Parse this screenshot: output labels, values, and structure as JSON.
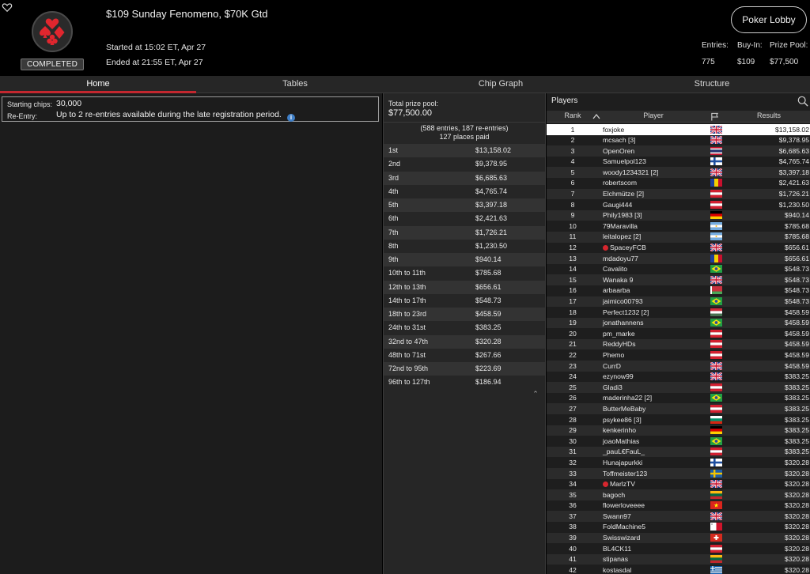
{
  "header": {
    "title": "$109 Sunday Fenomeno, $70K Gtd",
    "started": "Started at 15:02 ET, Apr 27",
    "ended": "Ended at 21:55 ET, Apr 27",
    "status": "COMPLETED",
    "lobby_button": "Poker Lobby",
    "stats": [
      {
        "label": "Entries:",
        "value": "775"
      },
      {
        "label": "Buy-In:",
        "value": "$109"
      },
      {
        "label": "Prize Pool:",
        "value": "$77,500"
      }
    ]
  },
  "tabs": [
    "Home",
    "Tables",
    "Chip Graph",
    "Structure"
  ],
  "active_tab": "Home",
  "info": {
    "starting_chips_label": "Starting chips:",
    "starting_chips_value": "30,000",
    "reentry_label": "Re-Entry:",
    "reentry_value": "Up to 2 re-entries available during the late registration period."
  },
  "prize": {
    "total_label": "Total prize pool:",
    "total_value": "$77,500.00",
    "entries_text": "(588 entries, 187 re-entries)",
    "places_text": "127 places paid",
    "rows": [
      {
        "place": "1st",
        "amount": "$13,158.02"
      },
      {
        "place": "2nd",
        "amount": "$9,378.95"
      },
      {
        "place": "3rd",
        "amount": "$6,685.63"
      },
      {
        "place": "4th",
        "amount": "$4,765.74"
      },
      {
        "place": "5th",
        "amount": "$3,397.18"
      },
      {
        "place": "6th",
        "amount": "$2,421.63"
      },
      {
        "place": "7th",
        "amount": "$1,726.21"
      },
      {
        "place": "8th",
        "amount": "$1,230.50"
      },
      {
        "place": "9th",
        "amount": "$940.14"
      },
      {
        "place": "10th to 11th",
        "amount": "$785.68"
      },
      {
        "place": "12th to 13th",
        "amount": "$656.61"
      },
      {
        "place": "14th to 17th",
        "amount": "$548.73"
      },
      {
        "place": "18th to 23rd",
        "amount": "$458.59"
      },
      {
        "place": "24th to 31st",
        "amount": "$383.25"
      },
      {
        "place": "32nd to 47th",
        "amount": "$320.28"
      },
      {
        "place": "48th to 71st",
        "amount": "$267.66"
      },
      {
        "place": "72nd to 95th",
        "amount": "$223.69"
      },
      {
        "place": "96th to 127th",
        "amount": "$186.94"
      }
    ]
  },
  "players": {
    "title": "Players",
    "columns": [
      "Rank",
      "Player",
      "Results"
    ],
    "rows": [
      {
        "rank": "1",
        "name": "foxjoke",
        "flag": "gb",
        "result": "$13,158.02",
        "selected": true
      },
      {
        "rank": "2",
        "name": "mcsach [3]",
        "flag": "gb",
        "result": "$9,378.95"
      },
      {
        "rank": "3",
        "name": "OpenOren",
        "flag": "th",
        "result": "$6,685.63"
      },
      {
        "rank": "4",
        "name": "Samuelpol123",
        "flag": "fi",
        "result": "$4,765.74"
      },
      {
        "rank": "5",
        "name": "woody1234321 [2]",
        "flag": "gb",
        "result": "$3,397.18"
      },
      {
        "rank": "6",
        "name": "robertscom",
        "flag": "ro",
        "result": "$2,421.63"
      },
      {
        "rank": "7",
        "name": "Elchmütze [2]",
        "flag": "at",
        "result": "$1,726.21"
      },
      {
        "rank": "8",
        "name": "Gaugi444",
        "flag": "at",
        "result": "$1,230.50"
      },
      {
        "rank": "9",
        "name": "Phily1983 [3]",
        "flag": "de",
        "result": "$940.14"
      },
      {
        "rank": "10",
        "name": "79Maravilla",
        "flag": "ar",
        "result": "$785.68"
      },
      {
        "rank": "11",
        "name": "leitalopez [2]",
        "flag": "ar",
        "result": "$785.68"
      },
      {
        "rank": "12",
        "name": "SpaceyFCB",
        "flag": "gb",
        "result": "$656.61",
        "badge": true
      },
      {
        "rank": "13",
        "name": "mdadoyu77",
        "flag": "ro",
        "result": "$656.61"
      },
      {
        "rank": "14",
        "name": "Cavalito",
        "flag": "br",
        "result": "$548.73"
      },
      {
        "rank": "15",
        "name": "Wanaka 9",
        "flag": "gb",
        "result": "$548.73"
      },
      {
        "rank": "16",
        "name": "arbaarba",
        "flag": "by",
        "result": "$548.73"
      },
      {
        "rank": "17",
        "name": "jaimico00793",
        "flag": "br",
        "result": "$548.73"
      },
      {
        "rank": "18",
        "name": "Perfect1232 [2]",
        "flag": "hu",
        "result": "$458.59"
      },
      {
        "rank": "19",
        "name": "jonathannens",
        "flag": "br",
        "result": "$458.59"
      },
      {
        "rank": "20",
        "name": "pm_marke",
        "flag": "at",
        "result": "$458.59"
      },
      {
        "rank": "21",
        "name": "ReddyHDs",
        "flag": "at",
        "result": "$458.59"
      },
      {
        "rank": "22",
        "name": "Phemo",
        "flag": "at",
        "result": "$458.59"
      },
      {
        "rank": "23",
        "name": "CurrD",
        "flag": "gb",
        "result": "$458.59"
      },
      {
        "rank": "24",
        "name": "ezynow99",
        "flag": "gb",
        "result": "$383.25"
      },
      {
        "rank": "25",
        "name": "Gladi3",
        "flag": "at",
        "result": "$383.25"
      },
      {
        "rank": "26",
        "name": "maderinha22 [2]",
        "flag": "br",
        "result": "$383.25"
      },
      {
        "rank": "27",
        "name": "ButterMeBaby",
        "flag": "at",
        "result": "$383.25"
      },
      {
        "rank": "28",
        "name": "psykee86 [3]",
        "flag": "bg",
        "result": "$383.25"
      },
      {
        "rank": "29",
        "name": "kenkerinho",
        "flag": "de",
        "result": "$383.25"
      },
      {
        "rank": "30",
        "name": "joaoMathias",
        "flag": "br",
        "result": "$383.25"
      },
      {
        "rank": "31",
        "name": "_pauL€FauL_",
        "flag": "at",
        "result": "$383.25"
      },
      {
        "rank": "32",
        "name": "Hunajapurkki",
        "flag": "fi",
        "result": "$320.28"
      },
      {
        "rank": "33",
        "name": "Toffmeister123",
        "flag": "se",
        "result": "$320.28"
      },
      {
        "rank": "34",
        "name": "MarlzTV",
        "flag": "gb",
        "result": "$320.28",
        "badge": true
      },
      {
        "rank": "35",
        "name": "bagoch",
        "flag": "lt",
        "result": "$320.28"
      },
      {
        "rank": "36",
        "name": "flowerloveeee",
        "flag": "vn",
        "result": "$320.28"
      },
      {
        "rank": "37",
        "name": "Swann97",
        "flag": "gb",
        "result": "$320.28"
      },
      {
        "rank": "38",
        "name": "FoldMachine5",
        "flag": "mt",
        "result": "$320.28"
      },
      {
        "rank": "39",
        "name": "Swisswizard",
        "flag": "ch",
        "result": "$320.28"
      },
      {
        "rank": "40",
        "name": "BL4CK11",
        "flag": "at",
        "result": "$320.28"
      },
      {
        "rank": "41",
        "name": "stipanas",
        "flag": "lt",
        "result": "$320.28"
      },
      {
        "rank": "42",
        "name": "kostasdal",
        "flag": "gr",
        "result": "$320.28"
      }
    ]
  },
  "colors": {
    "accent": "#c3272f",
    "selected_row": "#ffffff",
    "badge": "#d6262e"
  }
}
